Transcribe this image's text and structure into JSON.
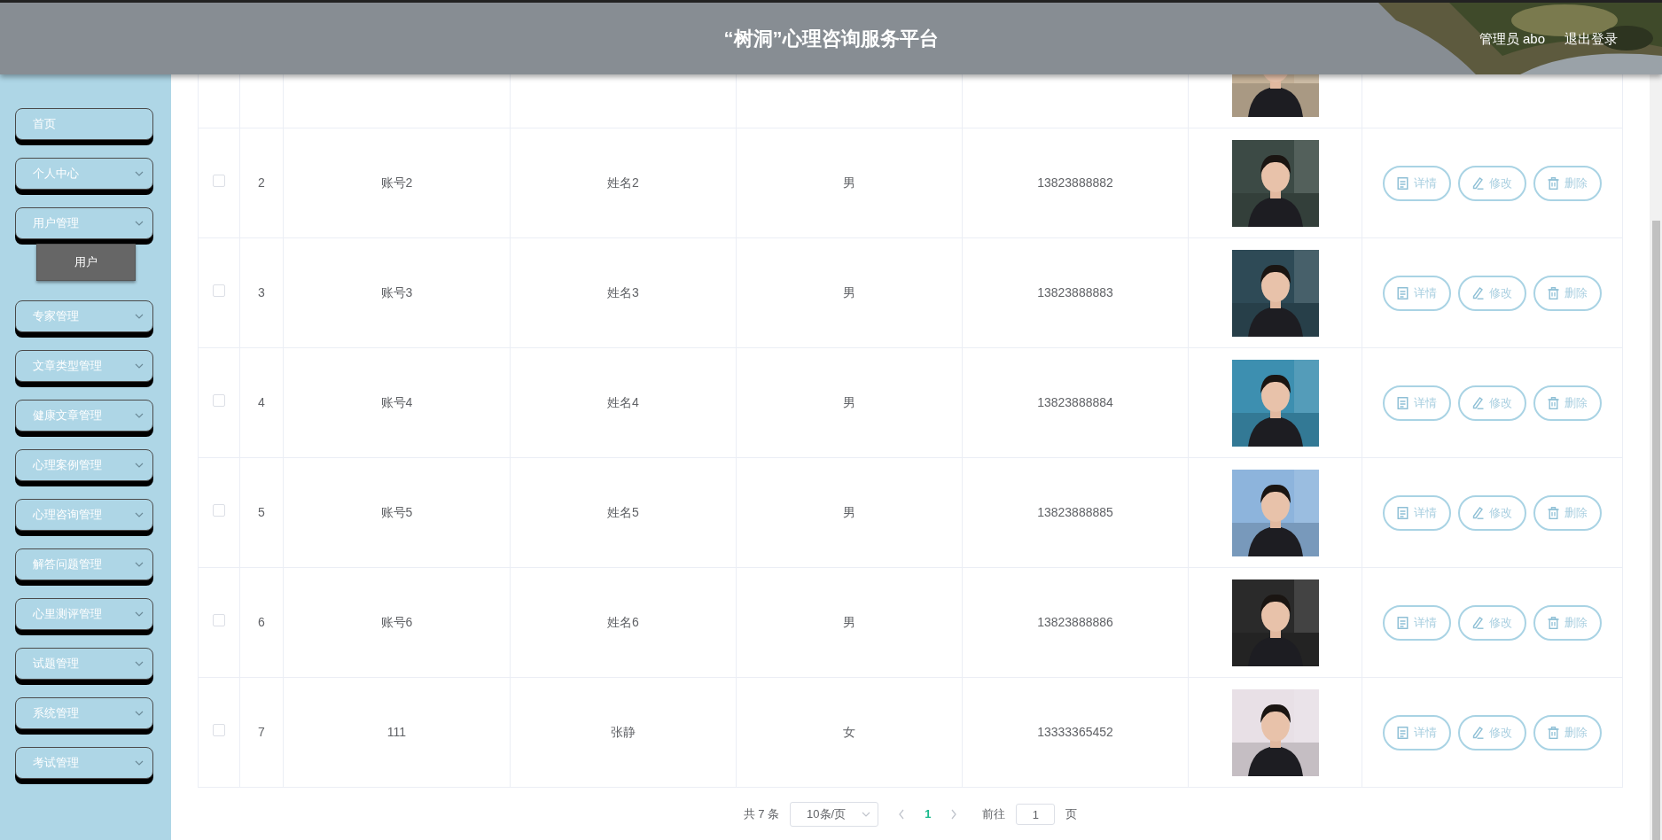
{
  "header": {
    "title": "“树洞”心理咨询服务平台",
    "user": "管理员 abo",
    "logout": "退出登录"
  },
  "sidebar": {
    "items": [
      {
        "label": "首页",
        "kind": "link"
      },
      {
        "label": "个人中心",
        "kind": "menu"
      },
      {
        "label": "用户管理",
        "kind": "menu",
        "children": [
          {
            "label": "用户",
            "selected": true
          }
        ]
      },
      {
        "label": "专家管理",
        "kind": "menu"
      },
      {
        "label": "文章类型管理",
        "kind": "menu"
      },
      {
        "label": "健康文章管理",
        "kind": "menu"
      },
      {
        "label": "心理案例管理",
        "kind": "menu"
      },
      {
        "label": "心理咨询管理",
        "kind": "menu"
      },
      {
        "label": "解答问题管理",
        "kind": "menu"
      },
      {
        "label": "心里测评管理",
        "kind": "menu"
      },
      {
        "label": "试题管理",
        "kind": "menu"
      },
      {
        "label": "系统管理",
        "kind": "menu"
      },
      {
        "label": "考试管理",
        "kind": "menu"
      }
    ]
  },
  "table": {
    "rows": [
      {
        "photo": {
          "kind": "picture"
        }
      },
      {
        "checked": false,
        "index": "2",
        "account": "账号2",
        "name": "姓名2",
        "gender": "男",
        "phone": "13823888882",
        "photo": {
          "kind": "picture"
        },
        "actions": [
          "详情",
          "修改",
          "删除"
        ]
      },
      {
        "checked": false,
        "index": "3",
        "account": "账号3",
        "name": "姓名3",
        "gender": "男",
        "phone": "13823888883",
        "photo": {
          "kind": "picture"
        },
        "actions": [
          "详情",
          "修改",
          "删除"
        ]
      },
      {
        "checked": false,
        "index": "4",
        "account": "账号4",
        "name": "姓名4",
        "gender": "男",
        "phone": "13823888884",
        "photo": {
          "kind": "picture"
        },
        "actions": [
          "详情",
          "修改",
          "删除"
        ]
      },
      {
        "checked": false,
        "index": "5",
        "account": "账号5",
        "name": "姓名5",
        "gender": "男",
        "phone": "13823888885",
        "photo": {
          "kind": "picture"
        },
        "actions": [
          "详情",
          "修改",
          "删除"
        ]
      },
      {
        "checked": false,
        "index": "6",
        "account": "账号6",
        "name": "姓名6",
        "gender": "男",
        "phone": "13823888886",
        "photo": {
          "kind": "picture"
        },
        "actions": [
          "详情",
          "修改",
          "删除"
        ]
      },
      {
        "checked": false,
        "index": "7",
        "account": "111",
        "name": "张静",
        "gender": "女",
        "phone": "13333365452",
        "photo": {
          "kind": "picture"
        },
        "actions": [
          "详情",
          "修改",
          "删除"
        ]
      }
    ]
  },
  "pagination": {
    "total": "共 7 条",
    "page_size": "10条/页",
    "pages": [
      {
        "label": "1",
        "selected": true
      }
    ],
    "goto_label": "前往",
    "goto_value": "1",
    "page_unit": "页"
  }
}
